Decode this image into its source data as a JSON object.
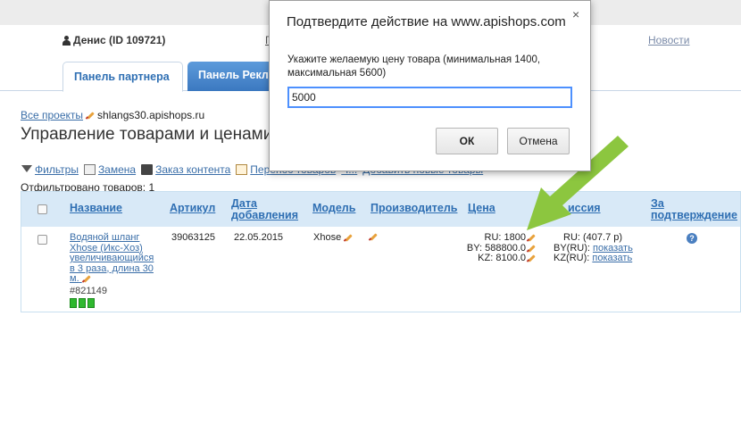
{
  "header": {
    "user_name": "Денис (ID 109721)",
    "partial_link": "Г",
    "news_link": "Новости"
  },
  "tabs": [
    {
      "label": "Панель партнера"
    },
    {
      "label": "Панель Рекла"
    }
  ],
  "breadcrumb": {
    "all_projects": "Все проекты",
    "current": "shlangs30.apishops.ru"
  },
  "page_title": "Управление товарами и ценами",
  "toolbar": [
    {
      "label": "Фильтры",
      "icon": "filter-icon"
    },
    {
      "label": "Замена",
      "icon": "replace-icon"
    },
    {
      "label": "Заказ контента",
      "icon": "order-content-icon"
    },
    {
      "label": "Перенос товаров",
      "icon": "transfer-icon"
    },
    {
      "label": "Ч...",
      "icon": "tag-icon"
    },
    {
      "label": "Добавить новые товары",
      "icon": "add-icon"
    }
  ],
  "filtered_count_text": "Отфильтровано товаров: 1",
  "table": {
    "headers": {
      "name": "Название",
      "article": "Артикул",
      "date_line1": "Дата",
      "date_line2": "добавления",
      "model": "Модель",
      "manufacturer": "Производитель",
      "price": "Цена",
      "commission": "иссия",
      "confirm_line1": "За",
      "confirm_line2": "подтверждение"
    },
    "rows": [
      {
        "name_lines": [
          "Водяной шланг",
          "Xhose (Икс-Хоз)",
          "увеличивающийся",
          "в 3 раза, длина 30",
          "м."
        ],
        "sku": "#821149",
        "article": "39063125",
        "date": "22.05.2015",
        "model": "Xhose",
        "prices": [
          {
            "label": "RU:",
            "value": "1800"
          },
          {
            "label": "BY:",
            "value": "588800.0"
          },
          {
            "label": "KZ:",
            "value": "8100.0"
          }
        ],
        "commission": {
          "ru": "RU: (407.7 р)",
          "by_label": "BY(RU):",
          "kz_label": "KZ(RU):",
          "show_link": "показать"
        }
      }
    ]
  },
  "dialog": {
    "title": "Подтвердите действие на www.apishops.com",
    "close_glyph": "×",
    "message": "Укажите желаемую цену товара (минимальная 1400, максимальная 5600)",
    "input_value": "5000",
    "ok_label": "ОК",
    "cancel_label": "Отмена"
  },
  "colors": {
    "accent": "#2f6fb3",
    "arrow": "#8cc63f"
  }
}
